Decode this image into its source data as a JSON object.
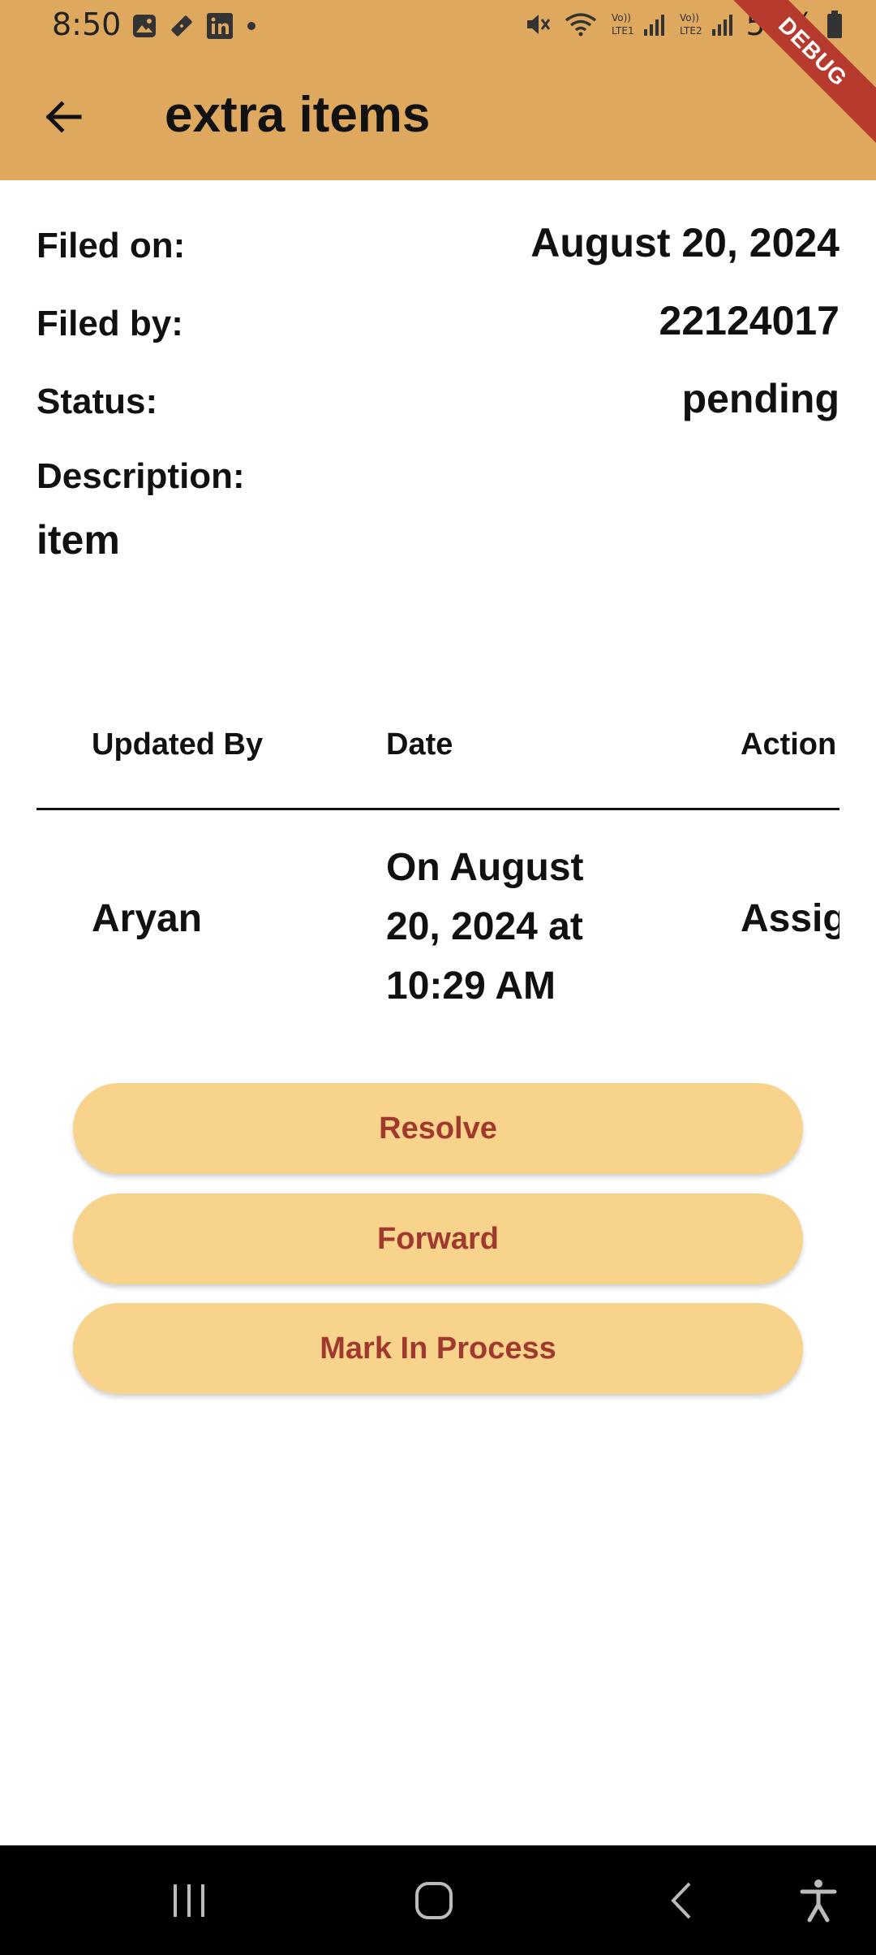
{
  "status_bar": {
    "time": "8:50",
    "battery": "55%",
    "left_icons": [
      "gallery-icon",
      "ticket-icon",
      "linkedin-icon",
      "dot-icon"
    ],
    "right_icons": [
      "mute-icon",
      "wifi-icon",
      "signal-lte1-icon",
      "signal-lte2-icon",
      "battery-icon"
    ]
  },
  "app_bar": {
    "title": "extra items",
    "back_icon": "arrow-left-icon",
    "color": "#DFA85F",
    "debug_label": "DEBUG"
  },
  "details": {
    "filed_on_label": "Filed on:",
    "filed_on_value": "August 20, 2024",
    "filed_by_label": "Filed by:",
    "filed_by_value": "22124017",
    "status_label": "Status:",
    "status_value": "pending",
    "description_label": "Description:",
    "description_value": "item"
  },
  "history_table": {
    "headers": [
      "Updated By",
      "Date",
      "Action"
    ],
    "rows": [
      {
        "updated_by": "Aryan",
        "date": "On August 20, 2024 at 10:29 AM",
        "action": "Assig"
      }
    ]
  },
  "actions": {
    "resolve": "Resolve",
    "forward": "Forward",
    "mark_in_process": "Mark In Process",
    "button_color": "#F8D38B",
    "text_color": "#A03A2E"
  },
  "nav_bar": {
    "icons": [
      "recent-apps-icon",
      "home-icon",
      "back-icon",
      "accessibility-icon"
    ]
  }
}
